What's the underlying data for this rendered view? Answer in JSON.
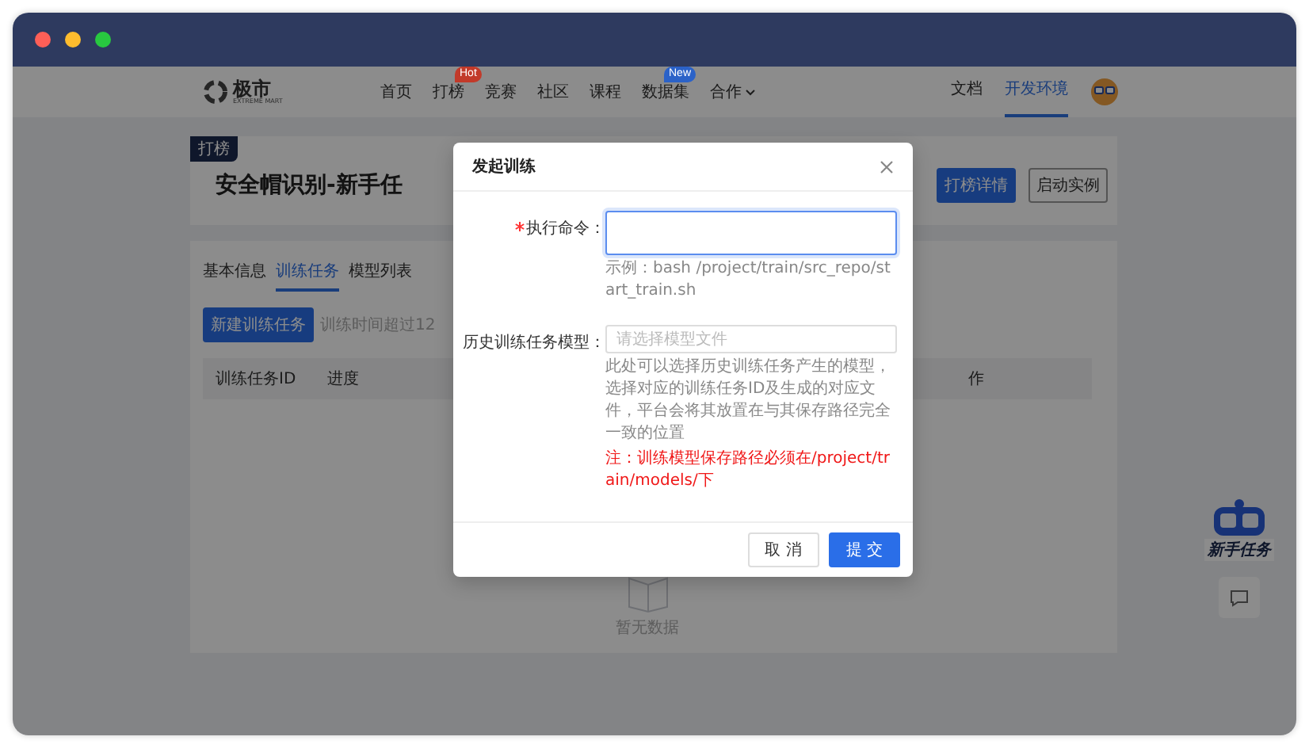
{
  "site": {
    "logo": "极市",
    "logo_sub": "EXTREME MART"
  },
  "nav": [
    {
      "label": "首页"
    },
    {
      "label": "打榜",
      "badge": "Hot",
      "color": "#c23a2a"
    },
    {
      "label": "竞赛"
    },
    {
      "label": "社区"
    },
    {
      "label": "课程"
    },
    {
      "label": "数据集",
      "badge": "New",
      "color": "#2b62c8"
    },
    {
      "label": "合作",
      "dropdown": true
    }
  ],
  "nav_right": [
    {
      "label": "文档",
      "selected": false
    },
    {
      "label": "开发环境",
      "selected": true
    }
  ],
  "header": {
    "tag": "打榜",
    "title": "安全帽识别-新手任",
    "buttons": [
      {
        "label": "打榜详情",
        "kind": "primary"
      },
      {
        "label": "启动实例",
        "kind": "default"
      }
    ]
  },
  "tabs": [
    {
      "label": "基本信息",
      "selected": false
    },
    {
      "label": "训练任务",
      "selected": true
    },
    {
      "label": "模型列表",
      "selected": false
    }
  ],
  "toolbar": {
    "button": "新建训练任务",
    "note": "训练时间超过12"
  },
  "table": {
    "columns": [
      "训练任务ID",
      "进度"
    ],
    "column_3": "作",
    "empty_text": "暂无数据"
  },
  "widget": {
    "label": "新手任务"
  },
  "dialog": {
    "title": "发起训练",
    "fields": [
      {
        "kind": "textarea",
        "label": "执行命令：",
        "required": true,
        "hint": "示例：bash /project/train/src_repo/start_train.sh"
      },
      {
        "kind": "select",
        "label": "历史训练任务模型：",
        "required": false,
        "placeholder": "请选择模型文件",
        "help": "此处可以选择历史训练任务产生的模型，选择对应的训练任务ID及生成的对应文件，平台会将其放置在与其保存路径完全一致的位置",
        "warning": "注：训练模型保存路径必须在/project/train/models/下"
      }
    ],
    "buttons": [
      {
        "label": "取 消",
        "kind": "default"
      },
      {
        "label": "提 交",
        "kind": "primary"
      }
    ]
  }
}
